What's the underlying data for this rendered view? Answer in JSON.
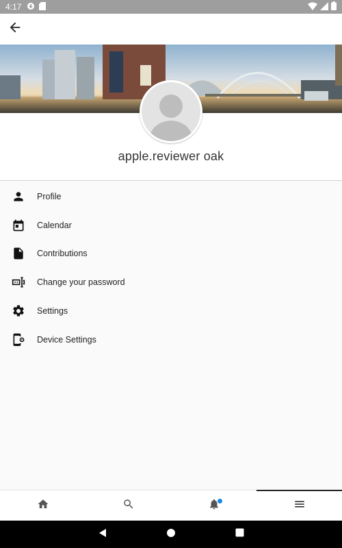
{
  "status_bar": {
    "time": "4:17",
    "icons_left": [
      "data-saver-icon",
      "sd-card-icon"
    ],
    "icons_right": [
      "wifi-icon",
      "cell-signal-icon",
      "battery-icon"
    ]
  },
  "app_bar": {
    "back_icon": "arrow-back-icon"
  },
  "hero": {
    "description_icon": "city-skyline-banner"
  },
  "profile": {
    "username": "apple.reviewer oak",
    "avatar_icon": "default-avatar-icon"
  },
  "menu": {
    "items": [
      {
        "label": "Profile",
        "icon": "person-icon"
      },
      {
        "label": "Calendar",
        "icon": "calendar-icon"
      },
      {
        "label": "Contributions",
        "icon": "document-icon"
      },
      {
        "label": "Change your password",
        "icon": "password-icon"
      },
      {
        "label": "Settings",
        "icon": "gear-icon"
      },
      {
        "label": "Device Settings",
        "icon": "device-settings-icon"
      }
    ]
  },
  "bottom_nav": {
    "items": [
      {
        "icon": "home-icon"
      },
      {
        "icon": "search-icon"
      },
      {
        "icon": "bell-icon",
        "notification": true
      },
      {
        "icon": "menu-icon",
        "active": true
      }
    ]
  },
  "system_nav": {
    "icons": [
      "back-triangle-icon",
      "home-circle-icon",
      "recents-square-icon"
    ]
  },
  "colors": {
    "notification_dot": "#1e88e5",
    "status_bar": "#9e9e9e",
    "accent_text": "#222222"
  }
}
